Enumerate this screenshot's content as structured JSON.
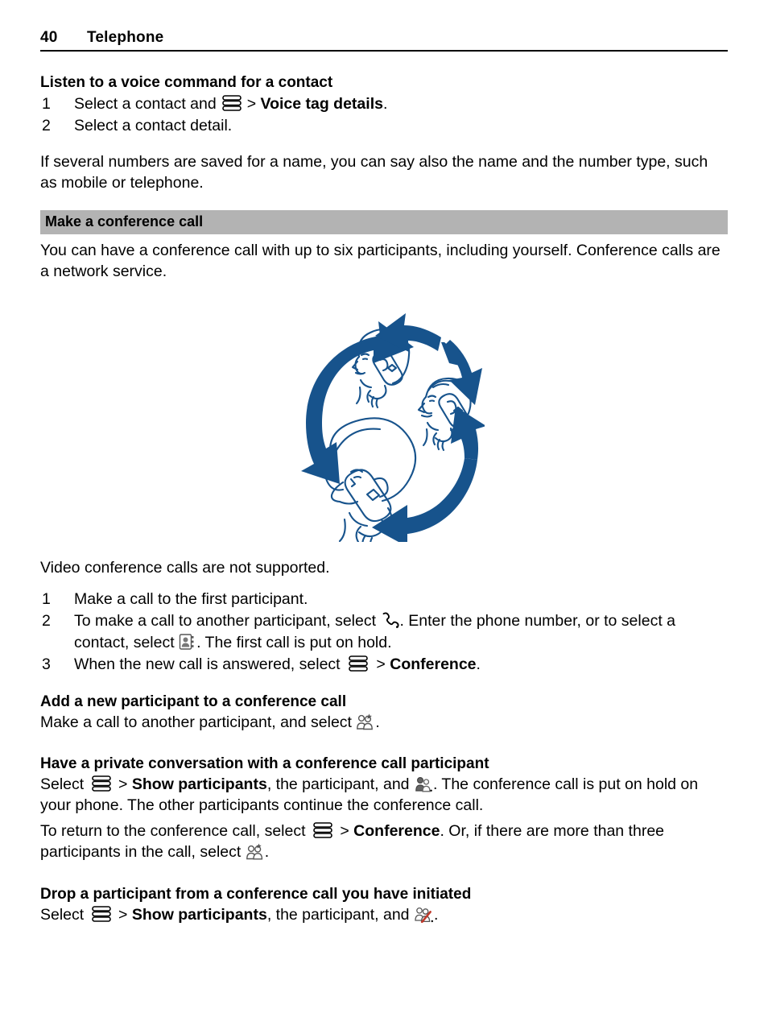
{
  "header": {
    "page_number": "40",
    "title": "Telephone"
  },
  "section_voice": {
    "heading": "Listen to a voice command for a contact",
    "steps": [
      {
        "num": "1",
        "text_before": "Select a contact and",
        "icon": "options-menu-icon",
        "separator": ">",
        "bold_text": "Voice tag details",
        "text_after": "."
      },
      {
        "num": "2",
        "text_before": "Select a contact detail.",
        "icon": "",
        "separator": "",
        "bold_text": "",
        "text_after": ""
      }
    ],
    "note": "If several numbers are saved for a name, you can say also the name and the number type, such as mobile or telephone."
  },
  "section_conference": {
    "bar_title": "Make a conference call",
    "intro": "You can have a conference call with up to six participants, including yourself. Conference calls are a network service.",
    "illustration": {
      "name": "three-people-conference-call-illustration",
      "color": "#17538c",
      "description": "Three people talking on mobile phones connected by circular arrows"
    },
    "video_note": "Video conference calls are not supported.",
    "steps": [
      {
        "num": "1",
        "parts": [
          {
            "type": "text",
            "value": "Make a call to the first participant."
          }
        ]
      },
      {
        "num": "2",
        "parts": [
          {
            "type": "text",
            "value": "To make a call to another participant, select "
          },
          {
            "type": "icon",
            "value": "phone-handset-icon"
          },
          {
            "type": "text",
            "value": ". Enter the phone number, or to select a contact, select "
          },
          {
            "type": "icon",
            "value": "contacts-card-icon"
          },
          {
            "type": "text",
            "value": ". The first call is put on hold."
          }
        ]
      },
      {
        "num": "3",
        "parts": [
          {
            "type": "text",
            "value": "When the new call is answered, select "
          },
          {
            "type": "icon",
            "value": "options-menu-icon"
          },
          {
            "type": "text",
            "value": " > "
          },
          {
            "type": "bold",
            "value": "Conference"
          },
          {
            "type": "text",
            "value": "."
          }
        ]
      }
    ]
  },
  "section_add_participant": {
    "heading": "Add a new participant to a conference call",
    "parts": [
      {
        "type": "text",
        "value": "Make a call to another participant, and select "
      },
      {
        "type": "icon",
        "value": "add-participant-icon"
      },
      {
        "type": "text",
        "value": "."
      }
    ]
  },
  "section_private": {
    "heading": "Have a private conversation with a conference call participant",
    "paragraph1_parts": [
      {
        "type": "text",
        "value": "Select "
      },
      {
        "type": "icon",
        "value": "options-menu-icon"
      },
      {
        "type": "text",
        "value": " > "
      },
      {
        "type": "bold",
        "value": "Show participants"
      },
      {
        "type": "text",
        "value": ", the participant, and "
      },
      {
        "type": "icon",
        "value": "private-conversation-icon"
      },
      {
        "type": "text",
        "value": ". The conference call is put on hold on your phone. The other participants continue the conference call."
      }
    ],
    "paragraph2_parts": [
      {
        "type": "text",
        "value": "To return to the conference call, select "
      },
      {
        "type": "icon",
        "value": "options-menu-icon"
      },
      {
        "type": "text",
        "value": " > "
      },
      {
        "type": "bold",
        "value": "Conference"
      },
      {
        "type": "text",
        "value": ". Or, if there are more than three participants in the call, select "
      },
      {
        "type": "icon",
        "value": "conference-group-icon"
      },
      {
        "type": "text",
        "value": "."
      }
    ]
  },
  "section_drop": {
    "heading": "Drop a participant from a conference call you have initiated",
    "parts": [
      {
        "type": "text",
        "value": "Select "
      },
      {
        "type": "icon",
        "value": "options-menu-icon"
      },
      {
        "type": "text",
        "value": " > "
      },
      {
        "type": "bold",
        "value": "Show participants"
      },
      {
        "type": "text",
        "value": ", the participant, and "
      },
      {
        "type": "icon",
        "value": "drop-participant-icon"
      },
      {
        "type": "text",
        "value": "."
      }
    ]
  },
  "colors": {
    "illustration_blue": "#17538c",
    "section_bar_gray": "#b3b3b3",
    "drop_slash_red": "#c0392b",
    "text_black": "#000000"
  }
}
